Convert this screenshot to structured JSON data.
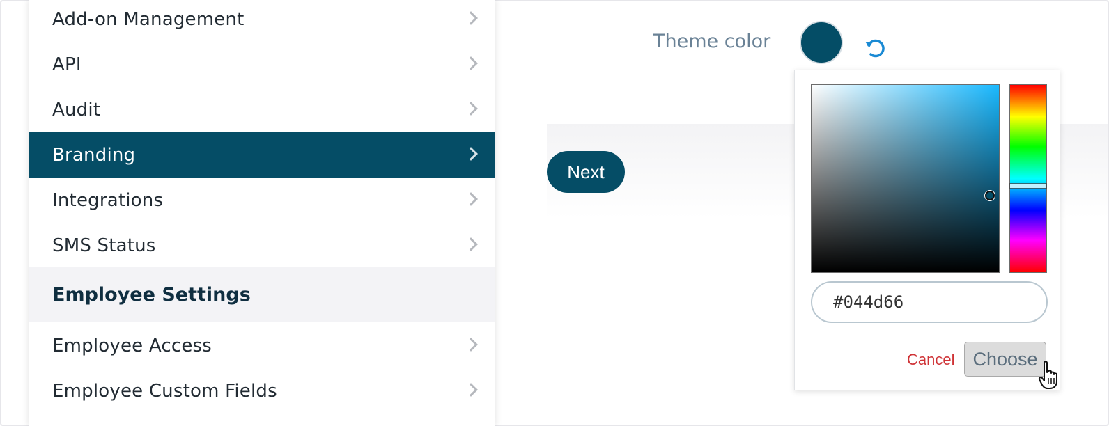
{
  "sidebar": {
    "items": [
      {
        "label": "Add-on Management"
      },
      {
        "label": "API"
      },
      {
        "label": "Audit"
      },
      {
        "label": "Branding",
        "active": true
      },
      {
        "label": "Integrations"
      },
      {
        "label": "SMS Status"
      }
    ],
    "section_header": "Employee Settings",
    "section_items": [
      {
        "label": "Employee Access"
      },
      {
        "label": "Employee Custom Fields"
      }
    ]
  },
  "branding": {
    "theme_label": "Theme color",
    "theme_color": "#044d66",
    "next_label": "Next"
  },
  "color_picker": {
    "hex_value": "#044d66",
    "hue_color": "#1ab9ff",
    "saturation": 0.95,
    "brightness": 0.41,
    "hue_fraction": 0.54,
    "cancel_label": "Cancel",
    "choose_label": "Choose"
  },
  "colors": {
    "accent": "#054d66",
    "cancel_red": "#cf3236",
    "label_gray": "#6a8296",
    "reset_blue": "#1a8ad4"
  },
  "icons": {
    "chevron": "chevron-right-icon",
    "reset": "reset-icon",
    "cursor": "hand-pointer-icon"
  }
}
